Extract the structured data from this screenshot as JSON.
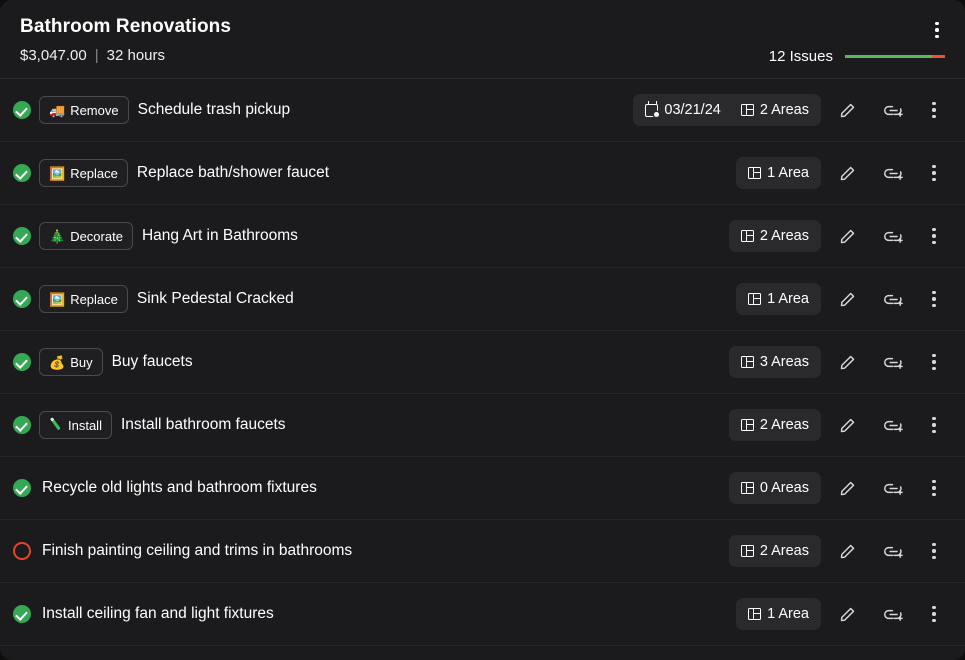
{
  "header": {
    "title": "Bathroom Renovations",
    "cost": "$3,047.00",
    "separator": "|",
    "hours": "32 hours",
    "issues_label": "12 Issues",
    "progress": {
      "done_pct": 87,
      "open_pct": 13,
      "done_color": "#5cb85c",
      "open_color": "#f0503a"
    },
    "menu_icon": "kebab-menu-icon"
  },
  "colors": {
    "card_bg": "#1b1b1d",
    "row_divider": "#262628",
    "chip_bg": "#2a2a2c",
    "status_done": "#34a853",
    "status_open": "#e8432a",
    "text": "#ffffff"
  },
  "row_actions": {
    "edit_label": "Edit",
    "link_label": "Add link",
    "menu_label": "More options"
  },
  "tasks": [
    {
      "status": "done",
      "tag": {
        "emoji": "🚚",
        "emoji_name": "delivery-truck-emoji",
        "label": "Remove"
      },
      "title": "Schedule trash pickup",
      "date": "03/21/24",
      "areas": "2 Areas"
    },
    {
      "status": "done",
      "tag": {
        "emoji": "🖼️",
        "emoji_name": "framed-picture-emoji",
        "label": "Replace"
      },
      "title": "Replace bath/shower faucet",
      "date": "",
      "areas": "1 Area"
    },
    {
      "status": "done",
      "tag": {
        "emoji": "🎄",
        "emoji_name": "christmas-tree-emoji",
        "label": "Decorate"
      },
      "title": "Hang Art in Bathrooms",
      "date": "",
      "areas": "2 Areas"
    },
    {
      "status": "done",
      "tag": {
        "emoji": "🖼️",
        "emoji_name": "framed-picture-emoji",
        "label": "Replace"
      },
      "title": "Sink Pedestal Cracked",
      "date": "",
      "areas": "1 Area"
    },
    {
      "status": "done",
      "tag": {
        "emoji": "💰",
        "emoji_name": "money-bag-emoji",
        "label": "Buy"
      },
      "title": "Buy faucets",
      "date": "",
      "areas": "3 Areas"
    },
    {
      "status": "done",
      "tag": {
        "emoji": "",
        "emoji_name": "screwdriver-emoji",
        "label": "Install"
      },
      "title": "Install bathroom faucets",
      "date": "",
      "areas": "2 Areas"
    },
    {
      "status": "done",
      "tag": null,
      "title": "Recycle old lights and bathroom fixtures",
      "date": "",
      "areas": "0 Areas"
    },
    {
      "status": "open",
      "tag": null,
      "title": "Finish painting ceiling and trims in bathrooms",
      "date": "",
      "areas": "2 Areas"
    },
    {
      "status": "done",
      "tag": null,
      "title": "Install ceiling fan and light fixtures",
      "date": "",
      "areas": "1 Area"
    }
  ]
}
